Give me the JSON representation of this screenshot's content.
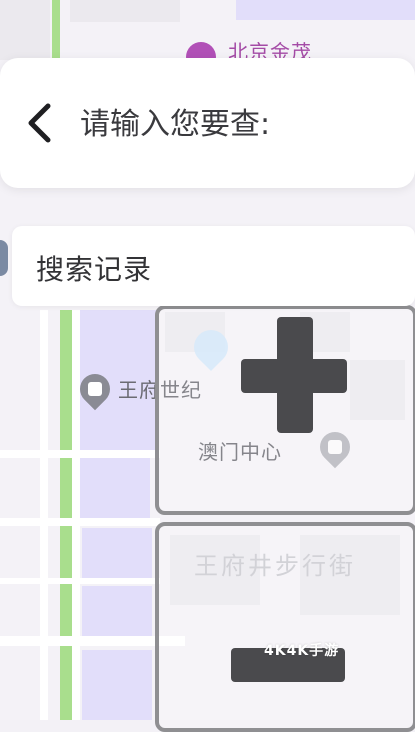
{
  "search": {
    "placeholder": "请输入您要查:",
    "value": ""
  },
  "history": {
    "label": "搜索记录"
  },
  "map": {
    "pois": [
      {
        "label": "北京金茂"
      },
      {
        "label": "王府世纪"
      },
      {
        "label": "澳门中心"
      },
      {
        "label": "王府井步行街"
      }
    ]
  },
  "controls": {
    "zoom_in_icon": "plus-icon",
    "zoom_out_icon": "minus-icon"
  },
  "watermark": "4K4K手游",
  "colors": {
    "map_background": "#f4f2f7",
    "park_green": "#a9de8d",
    "building_purple": "#e2defa",
    "poi_purple": "#b150b7",
    "zoom_icon": "#4a4a4d"
  }
}
